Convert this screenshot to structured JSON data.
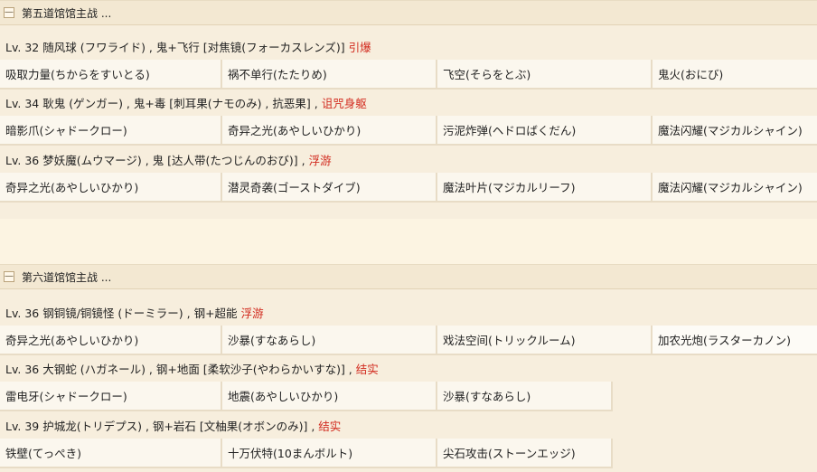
{
  "sections": [
    {
      "title": "第五道馆馆主战 ...",
      "toggle": "—",
      "pokemon": [
        {
          "info": "Lv. 32 随风球 (フワライド) , 鬼+飞行 [对焦镜(フォーカスレンズ)]",
          "ability": "引爆",
          "moves": [
            "吸取力量(ちからをすいとる)",
            "祸不单行(たたりめ)",
            "飞空(そらをとぶ)",
            "鬼火(おにび)"
          ]
        },
        {
          "info": "Lv. 34 耿鬼 (ゲンガー) , 鬼+毒 [刺耳果(ナモのみ) , 抗恶果] ,",
          "ability": "诅咒身躯",
          "moves": [
            "暗影爪(シャドークロー)",
            "奇异之光(あやしいひかり)",
            "污泥炸弹(ヘドロばくだん)",
            "魔法闪耀(マジカルシャイン)"
          ]
        },
        {
          "info": "Lv. 36 梦妖魔(ムウマージ) , 鬼 [达人带(たつじんのおび)] ,",
          "ability": "浮游",
          "moves": [
            "奇异之光(あやしいひかり)",
            "潜灵奇袭(ゴーストダイブ)",
            "魔法叶片(マジカルリーフ)",
            "魔法闪耀(マジカルシャイン)"
          ]
        }
      ]
    },
    {
      "title": "第六道馆馆主战 ...",
      "toggle": "—",
      "pokemon": [
        {
          "info": "Lv. 36 钢铜镜/铜镜怪 (ドーミラー) , 钢+超能",
          "ability": "浮游",
          "moves": [
            "奇异之光(あやしいひかり)",
            "沙暴(すなあらし)",
            "戏法空间(トリックルーム)",
            "加农光炮(ラスターカノン)"
          ]
        },
        {
          "info": "Lv. 36 大钢蛇 (ハガネール) , 钢+地面 [柔软沙子(やわらかいすな)] ,",
          "ability": "结实",
          "moves": [
            "雷电牙(シャドークロー)",
            "地震(あやしいひかり)",
            "沙暴(すなあらし)"
          ]
        },
        {
          "info": "Lv. 39 护城龙(トリデプス) , 钢+岩石 [文柚果(オボンのみ)] ,",
          "ability": "结实",
          "moves": [
            "铁壁(てっぺき)",
            "十万伏特(10まんボルト)",
            "尖石攻击(ストーンエッジ)"
          ]
        }
      ]
    }
  ]
}
